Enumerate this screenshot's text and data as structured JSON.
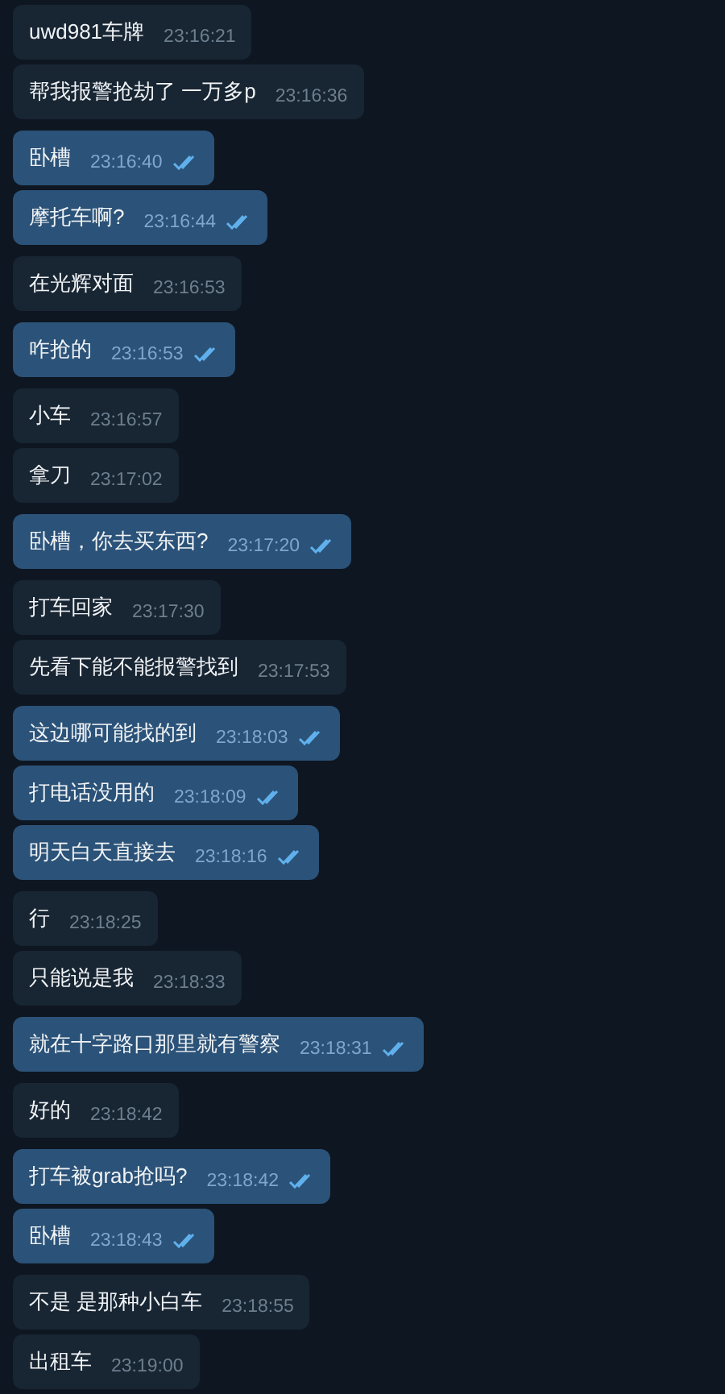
{
  "messages": [
    {
      "kind": "incoming",
      "text": "uwd981车牌",
      "time": "23:16:21"
    },
    {
      "kind": "incoming",
      "text": "帮我报警抢劫了 一万多p",
      "time": "23:16:36"
    },
    {
      "kind": "outgoing",
      "text": "卧槽",
      "time": "23:16:40",
      "read": true
    },
    {
      "kind": "outgoing",
      "text": "摩托车啊?",
      "time": "23:16:44",
      "read": true
    },
    {
      "kind": "incoming",
      "text": "在光辉对面",
      "time": "23:16:53"
    },
    {
      "kind": "outgoing",
      "text": "咋抢的",
      "time": "23:16:53",
      "read": true
    },
    {
      "kind": "incoming",
      "text": "小车",
      "time": "23:16:57"
    },
    {
      "kind": "incoming",
      "text": "拿刀",
      "time": "23:17:02"
    },
    {
      "kind": "outgoing",
      "text": "卧槽，你去买东西?",
      "time": "23:17:20",
      "read": true
    },
    {
      "kind": "incoming",
      "text": "打车回家",
      "time": "23:17:30"
    },
    {
      "kind": "incoming",
      "text": "先看下能不能报警找到",
      "time": "23:17:53"
    },
    {
      "kind": "outgoing",
      "text": "这边哪可能找的到",
      "time": "23:18:03",
      "read": true
    },
    {
      "kind": "outgoing",
      "text": "打电话没用的",
      "time": "23:18:09",
      "read": true
    },
    {
      "kind": "outgoing",
      "text": "明天白天直接去",
      "time": "23:18:16",
      "read": true
    },
    {
      "kind": "incoming",
      "text": "行",
      "time": "23:18:25"
    },
    {
      "kind": "incoming",
      "text": "只能说是我",
      "time": "23:18:33"
    },
    {
      "kind": "outgoing",
      "text": "就在十字路口那里就有警察",
      "time": "23:18:31",
      "read": true
    },
    {
      "kind": "incoming",
      "text": "好的",
      "time": "23:18:42"
    },
    {
      "kind": "outgoing",
      "text": "打车被grab抢吗?",
      "time": "23:18:42",
      "read": true
    },
    {
      "kind": "outgoing",
      "text": "卧槽",
      "time": "23:18:43",
      "read": true
    },
    {
      "kind": "incoming",
      "text": "不是 是那种小白车",
      "time": "23:18:55"
    },
    {
      "kind": "incoming",
      "text": "出租车",
      "time": "23:19:00"
    }
  ]
}
